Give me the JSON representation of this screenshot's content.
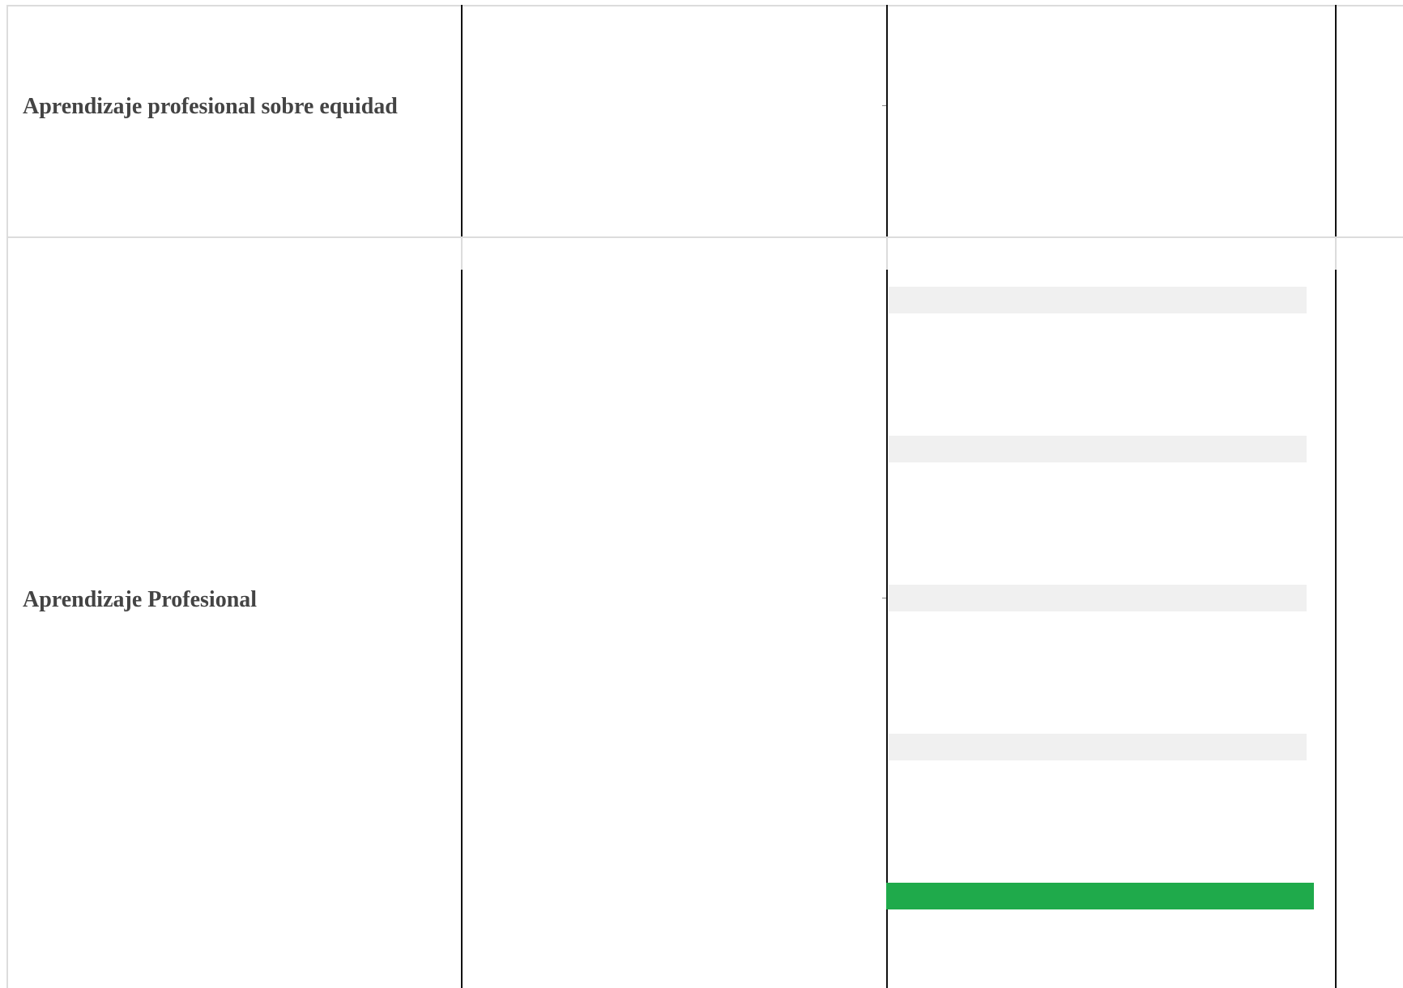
{
  "table": {
    "rows": [
      {
        "label": "Aprendizaje profesional sobre equidad"
      },
      {
        "label": "Aprendizaje Profesional",
        "bars": [
          {
            "level": 0
          },
          {
            "level": 0
          },
          {
            "level": 0
          },
          {
            "level": 0
          },
          {
            "level": 1
          }
        ]
      }
    ]
  },
  "colors": {
    "bar_fill": "#1faa4b",
    "bar_track": "#f0f0f0",
    "divider": "#dcdcdc",
    "column_rule": "#111111",
    "label_text": "#444444"
  }
}
